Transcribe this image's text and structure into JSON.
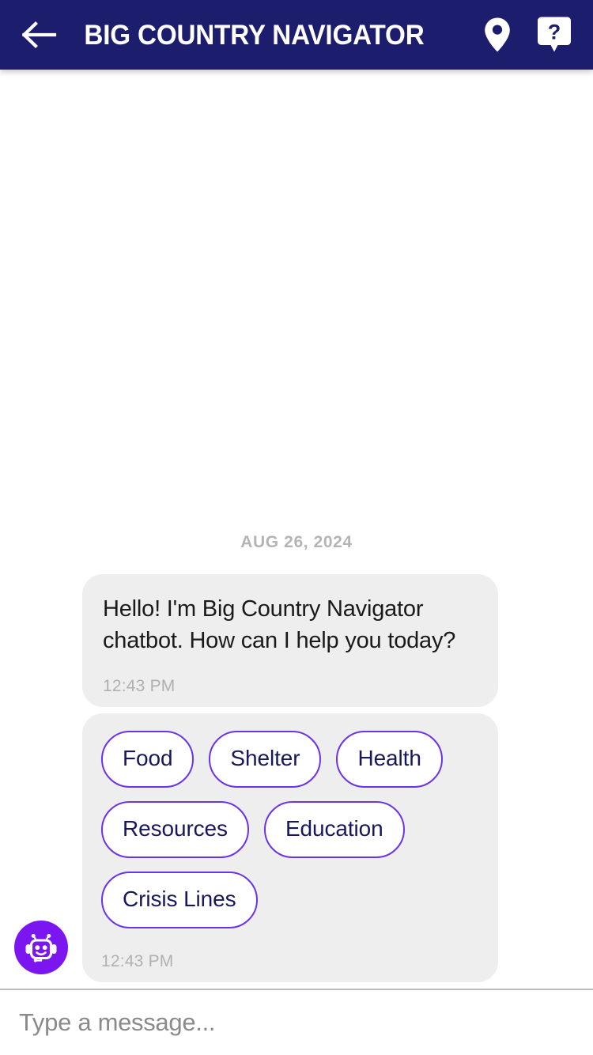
{
  "header": {
    "title": "BIG COUNTRY NAVIGATOR",
    "back_icon": "arrow-left-icon",
    "location_icon": "map-pin-icon",
    "help_icon": "help-question-bubble-icon",
    "background_color": "#1d1d6e",
    "text_color": "#ffffff"
  },
  "chat": {
    "date_separator": "AUG 26, 2024",
    "avatar_icon": "robot-avatar-icon",
    "avatar_color": "#7b16f0",
    "bubble_color": "#eeeeee",
    "messages": [
      {
        "sender": "bot",
        "text": "Hello! I'm Big Country Navigator chatbot. How can I help you today?",
        "time": "12:43 PM"
      },
      {
        "sender": "bot",
        "type": "quick_replies",
        "time": "12:43 PM",
        "options": [
          "Food",
          "Shelter",
          "Health",
          "Resources",
          "Education",
          "Crisis Lines"
        ]
      }
    ]
  },
  "composer": {
    "placeholder": "Type a message...",
    "value": ""
  },
  "colors": {
    "navy": "#1d1d6e",
    "purple": "#6a33ea",
    "avatar_purple": "#7b16f0",
    "chip_text": "#17175e",
    "muted": "#b0b0b0"
  }
}
